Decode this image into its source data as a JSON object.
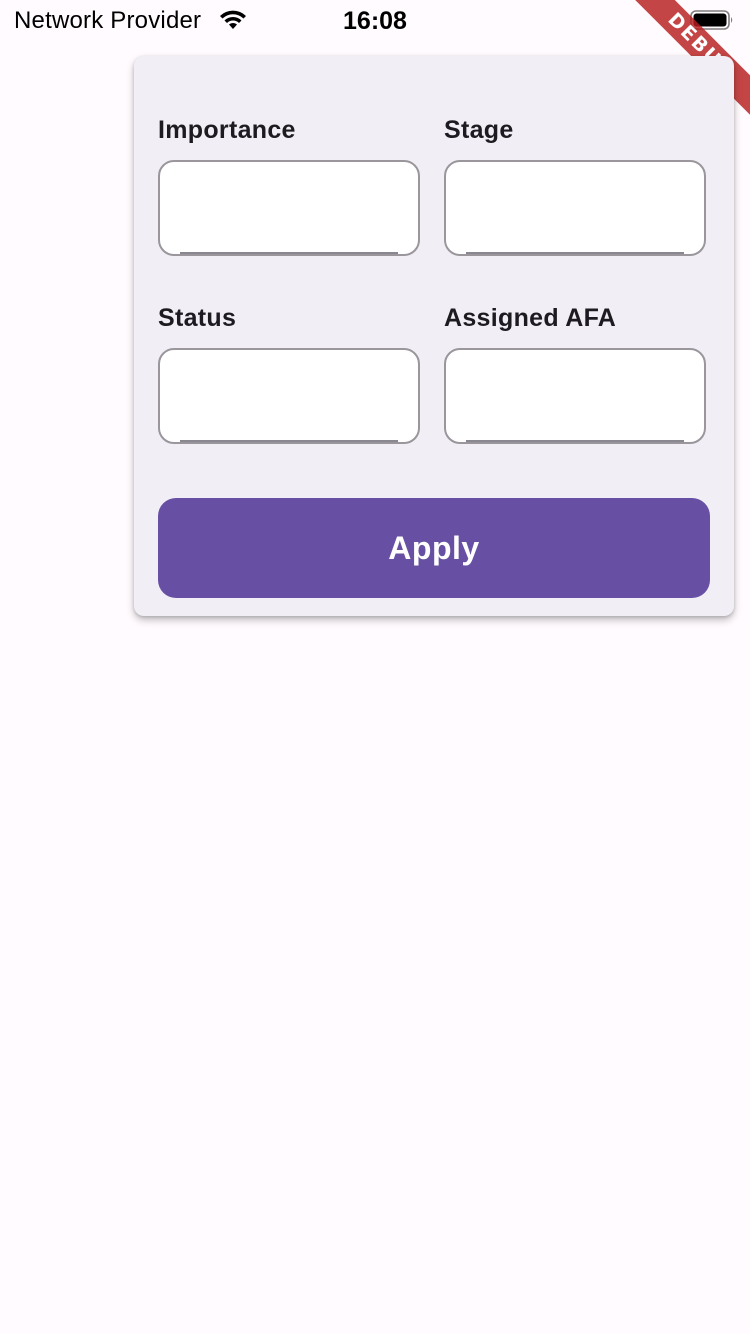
{
  "status_bar": {
    "carrier": "Network Provider",
    "time": "16:08",
    "wifi_icon": "wifi-icon",
    "battery_icon": "battery-icon"
  },
  "debug_banner": {
    "label": "DEBUG",
    "color": "#b71c1c"
  },
  "filters": {
    "fields": [
      {
        "label": "Importance",
        "value": ""
      },
      {
        "label": "Stage",
        "value": ""
      },
      {
        "label": "Status",
        "value": ""
      },
      {
        "label": "Assigned AFA",
        "value": ""
      }
    ],
    "apply_label": "Apply"
  },
  "colors": {
    "accent": "#6750a4",
    "panel_background": "#f2eef5",
    "page_background": "#fffbfe"
  }
}
